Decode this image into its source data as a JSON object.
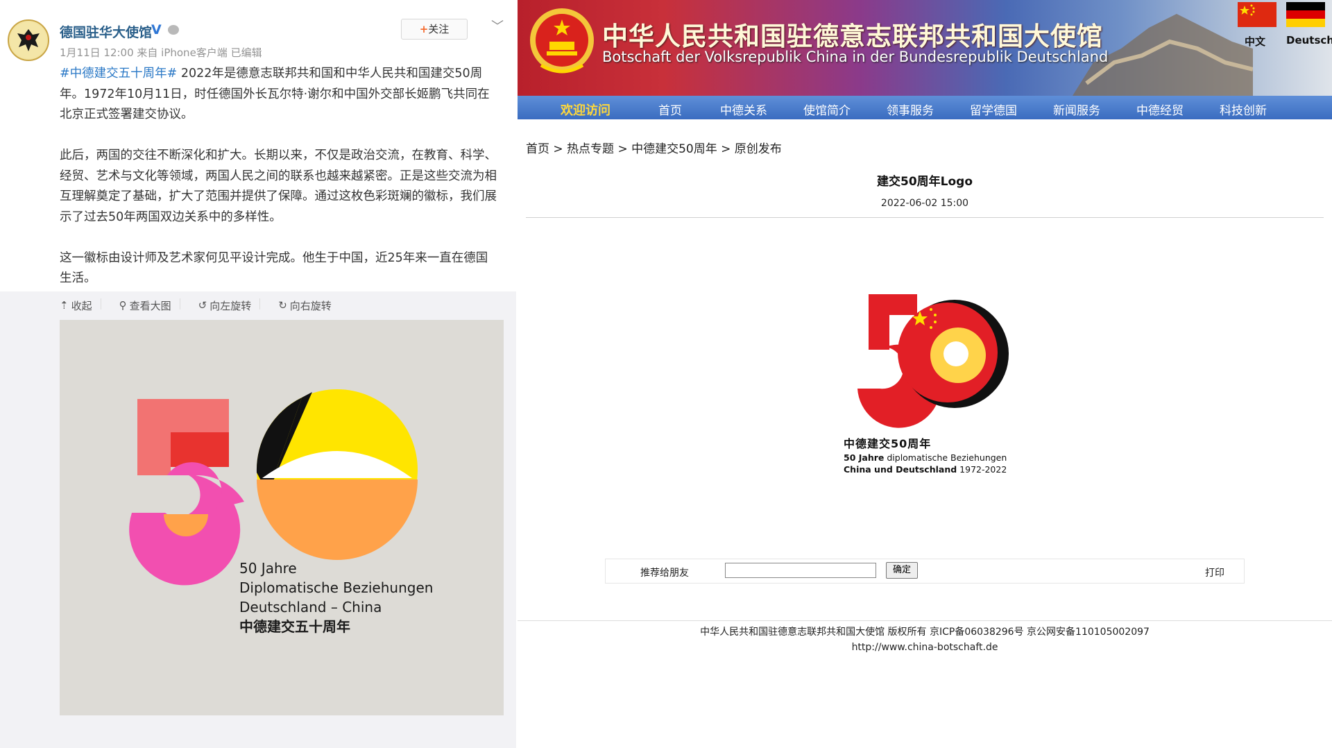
{
  "weibo": {
    "account_name": "德国驻华大使馆",
    "verified_mark": "V",
    "meta": "1月11日 12:00 来自 iPhone客户端   已编辑",
    "follow_label": "关注",
    "follow_plus": "+",
    "more_glyph": "﹀",
    "hashtag": "#中德建交五十周年#",
    "paragraph1_rest": " 2022年是德意志联邦共和国和中华人民共和国建交50周年。1972年10月11日，时任德国外长瓦尔特·谢尔和中国外交部长姬鹏飞共同在北京正式签署建交协议。",
    "paragraph2": "此后，两国的交往不断深化和扩大。长期以来，不仅是政治交流，在教育、科学、经贸、艺术与文化等领域，两国人民之间的联系也越来越紧密。正是这些交流为相互理解奠定了基础，扩大了范围并提供了保障。通过这枚色彩斑斓的徽标，我们展示了过去50年两国双边关系中的多样性。",
    "paragraph3": "这一徽标由设计师及艺术家何见平设计完成。他生于中国，近25年来一直在德国生活。",
    "toolbar": [
      {
        "icon": "collapse-icon",
        "glyph": "⇡",
        "label": "收起"
      },
      {
        "icon": "magnifier-icon",
        "glyph": "⚲",
        "label": "查看大图"
      },
      {
        "icon": "rotate-left-icon",
        "glyph": "↺",
        "label": "向左旋转"
      },
      {
        "icon": "rotate-right-icon",
        "glyph": "↻",
        "label": "向右旋转"
      }
    ],
    "logo_caption": {
      "line1": "50 Jahre",
      "line2": "Diplomatische Beziehungen",
      "line3": "Deutschland – China",
      "line4": "中德建交五十周年"
    }
  },
  "embassy": {
    "title_cn": "中华人民共和国驻德意志联邦共和国大使馆",
    "title_de": "Botschaft der Volksrepublik China in der Bundesrepublik Deutschland",
    "lang_cn": "中文",
    "lang_de": "Deutsch",
    "nav": [
      "欢迎访问",
      "首页",
      "中德关系",
      "使馆简介",
      "领事服务",
      "留学德国",
      "新闻服务",
      "中德经贸",
      "科技创新"
    ],
    "breadcrumb": "首页 > 热点专题 > 中德建交50周年 > 原创发布",
    "article_title": "建交50周年Logo",
    "article_date": "2022-06-02 15:00",
    "logo_text": {
      "line1": "中德建交50周年",
      "line2_bold": "50 Jahre",
      "line2_rest": " diplomatische Beziehungen",
      "line3_bold": "China und Deutschland",
      "line3_rest": " 1972-2022"
    },
    "recommend_label": "推荐给朋友",
    "recommend_input_value": "",
    "confirm_label": "确定",
    "print_label": "打印",
    "footer_line1": "中华人民共和国驻德意志联邦共和国大使馆 版权所有 京ICP备06038296号 京公网安备110105002097",
    "footer_line2": "http://www.china-botschaft.de"
  },
  "colors": {
    "weibo_link": "#2a78c6",
    "nav_bg": "#3a6cc0",
    "nav_welcome": "#ffd83a",
    "logo_red": "#e21f26",
    "logo_yellow": "#ffe500",
    "logo_pink": "#f24fb0",
    "logo_orange": "#ffa24a"
  }
}
